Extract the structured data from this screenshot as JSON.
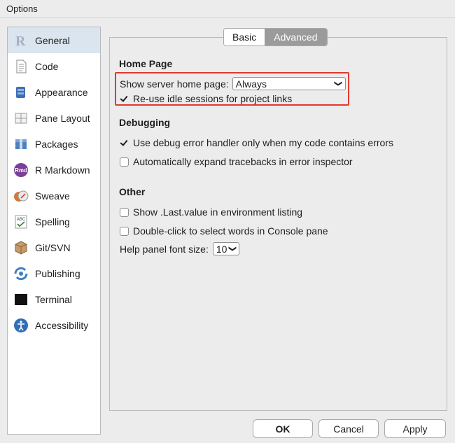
{
  "window": {
    "title": "Options"
  },
  "sidebar": {
    "items": [
      {
        "label": "General",
        "icon": "r-logo-icon",
        "selected": true
      },
      {
        "label": "Code",
        "icon": "code-document-icon",
        "selected": false
      },
      {
        "label": "Appearance",
        "icon": "paint-bucket-icon",
        "selected": false
      },
      {
        "label": "Pane Layout",
        "icon": "pane-layout-icon",
        "selected": false
      },
      {
        "label": "Packages",
        "icon": "packages-icon",
        "selected": false
      },
      {
        "label": "R Markdown",
        "icon": "rmarkdown-icon",
        "selected": false
      },
      {
        "label": "Sweave",
        "icon": "sweave-icon",
        "selected": false
      },
      {
        "label": "Spelling",
        "icon": "spelling-icon",
        "selected": false
      },
      {
        "label": "Git/SVN",
        "icon": "git-svn-icon",
        "selected": false
      },
      {
        "label": "Publishing",
        "icon": "publishing-icon",
        "selected": false
      },
      {
        "label": "Terminal",
        "icon": "terminal-icon",
        "selected": false
      },
      {
        "label": "Accessibility",
        "icon": "accessibility-icon",
        "selected": false
      }
    ],
    "rmd_icon_text": "Rmd",
    "abc_icon_text": "ABC"
  },
  "tabs": {
    "basic": "Basic",
    "advanced": "Advanced",
    "active": "advanced"
  },
  "home_page": {
    "title": "Home Page",
    "server_home_label": "Show server home page:",
    "server_home_value": "Always",
    "reuse_sessions_label": "Re-use idle sessions for project links",
    "reuse_sessions_checked": true
  },
  "debugging": {
    "title": "Debugging",
    "debug_handler_label": "Use debug error handler only when my code contains errors",
    "debug_handler_checked": true,
    "expand_tracebacks_label": "Automatically expand tracebacks in error inspector",
    "expand_tracebacks_checked": false
  },
  "other": {
    "title": "Other",
    "last_value_label": "Show .Last.value in environment listing",
    "last_value_checked": false,
    "double_click_label": "Double-click to select words in Console pane",
    "double_click_checked": false,
    "help_font_label": "Help panel font size:",
    "help_font_value": "10"
  },
  "buttons": {
    "ok": "OK",
    "cancel": "Cancel",
    "apply": "Apply"
  },
  "colors": {
    "highlight_border": "#e03a2f",
    "selected_item_bg": "#dbe5ef",
    "active_tab_bg": "#9b9b9b"
  }
}
